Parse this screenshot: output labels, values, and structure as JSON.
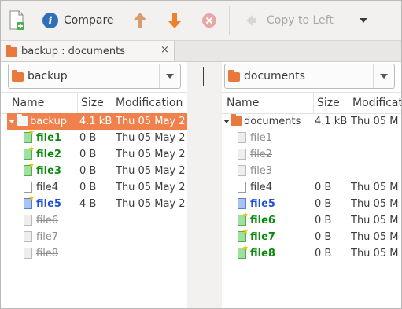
{
  "toolbar": {
    "new_icon": "new-comparison-icon",
    "info_icon": "info-icon",
    "compare_label": "Compare",
    "up_icon": "arrow-up-icon",
    "down_icon": "arrow-down-icon",
    "stop_icon": "stop-icon",
    "copy_label": "Copy to Left",
    "menu_icon": "chevron-down-icon"
  },
  "tab": {
    "title": "backup : documents",
    "close": "×"
  },
  "left": {
    "combo_value": "backup",
    "columns": {
      "name": "Name",
      "size": "Size",
      "modified": "Modification"
    },
    "rows": [
      {
        "name": "backup",
        "size": "4.1 kB",
        "date": "Thu 05 May 2",
        "status": "selected-folder"
      },
      {
        "name": "file1",
        "size": "0 B",
        "date": "Thu 05 May 2",
        "status": "new"
      },
      {
        "name": "file2",
        "size": "0 B",
        "date": "Thu 05 May 2",
        "status": "new"
      },
      {
        "name": "file3",
        "size": "0 B",
        "date": "Thu 05 May 2",
        "status": "new"
      },
      {
        "name": "file4",
        "size": "0 B",
        "date": "Thu 05 May 2",
        "status": "same"
      },
      {
        "name": "file5",
        "size": "4 B",
        "date": "Thu 05 May 2",
        "status": "modified"
      },
      {
        "name": "file6",
        "size": "",
        "date": "",
        "status": "missing"
      },
      {
        "name": "file7",
        "size": "",
        "date": "",
        "status": "missing"
      },
      {
        "name": "file8",
        "size": "",
        "date": "",
        "status": "missing"
      }
    ]
  },
  "right": {
    "combo_value": "documents",
    "columns": {
      "name": "Name",
      "size": "Size",
      "modified": "Modificatio"
    },
    "rows": [
      {
        "name": "documents",
        "size": "4.1 kB",
        "date": "Thu 05 M",
        "status": "folder"
      },
      {
        "name": "file1",
        "size": "",
        "date": "",
        "status": "missing"
      },
      {
        "name": "file2",
        "size": "",
        "date": "",
        "status": "missing"
      },
      {
        "name": "file3",
        "size": "",
        "date": "",
        "status": "missing"
      },
      {
        "name": "file4",
        "size": "0 B",
        "date": "Thu 05 M",
        "status": "same"
      },
      {
        "name": "file5",
        "size": "0 B",
        "date": "Thu 05 M",
        "status": "modified"
      },
      {
        "name": "file6",
        "size": "0 B",
        "date": "Thu 05 M",
        "status": "new"
      },
      {
        "name": "file7",
        "size": "0 B",
        "date": "Thu 05 M",
        "status": "new"
      },
      {
        "name": "file8",
        "size": "0 B",
        "date": "Thu 05 M",
        "status": "new"
      }
    ]
  },
  "colors": {
    "selection": "#f0814c",
    "new": "#0a8a0a",
    "modified": "#1d4ed8",
    "missing": "#8c8c8c",
    "arrow": "#e07b2e",
    "stop": "#d9534f"
  }
}
